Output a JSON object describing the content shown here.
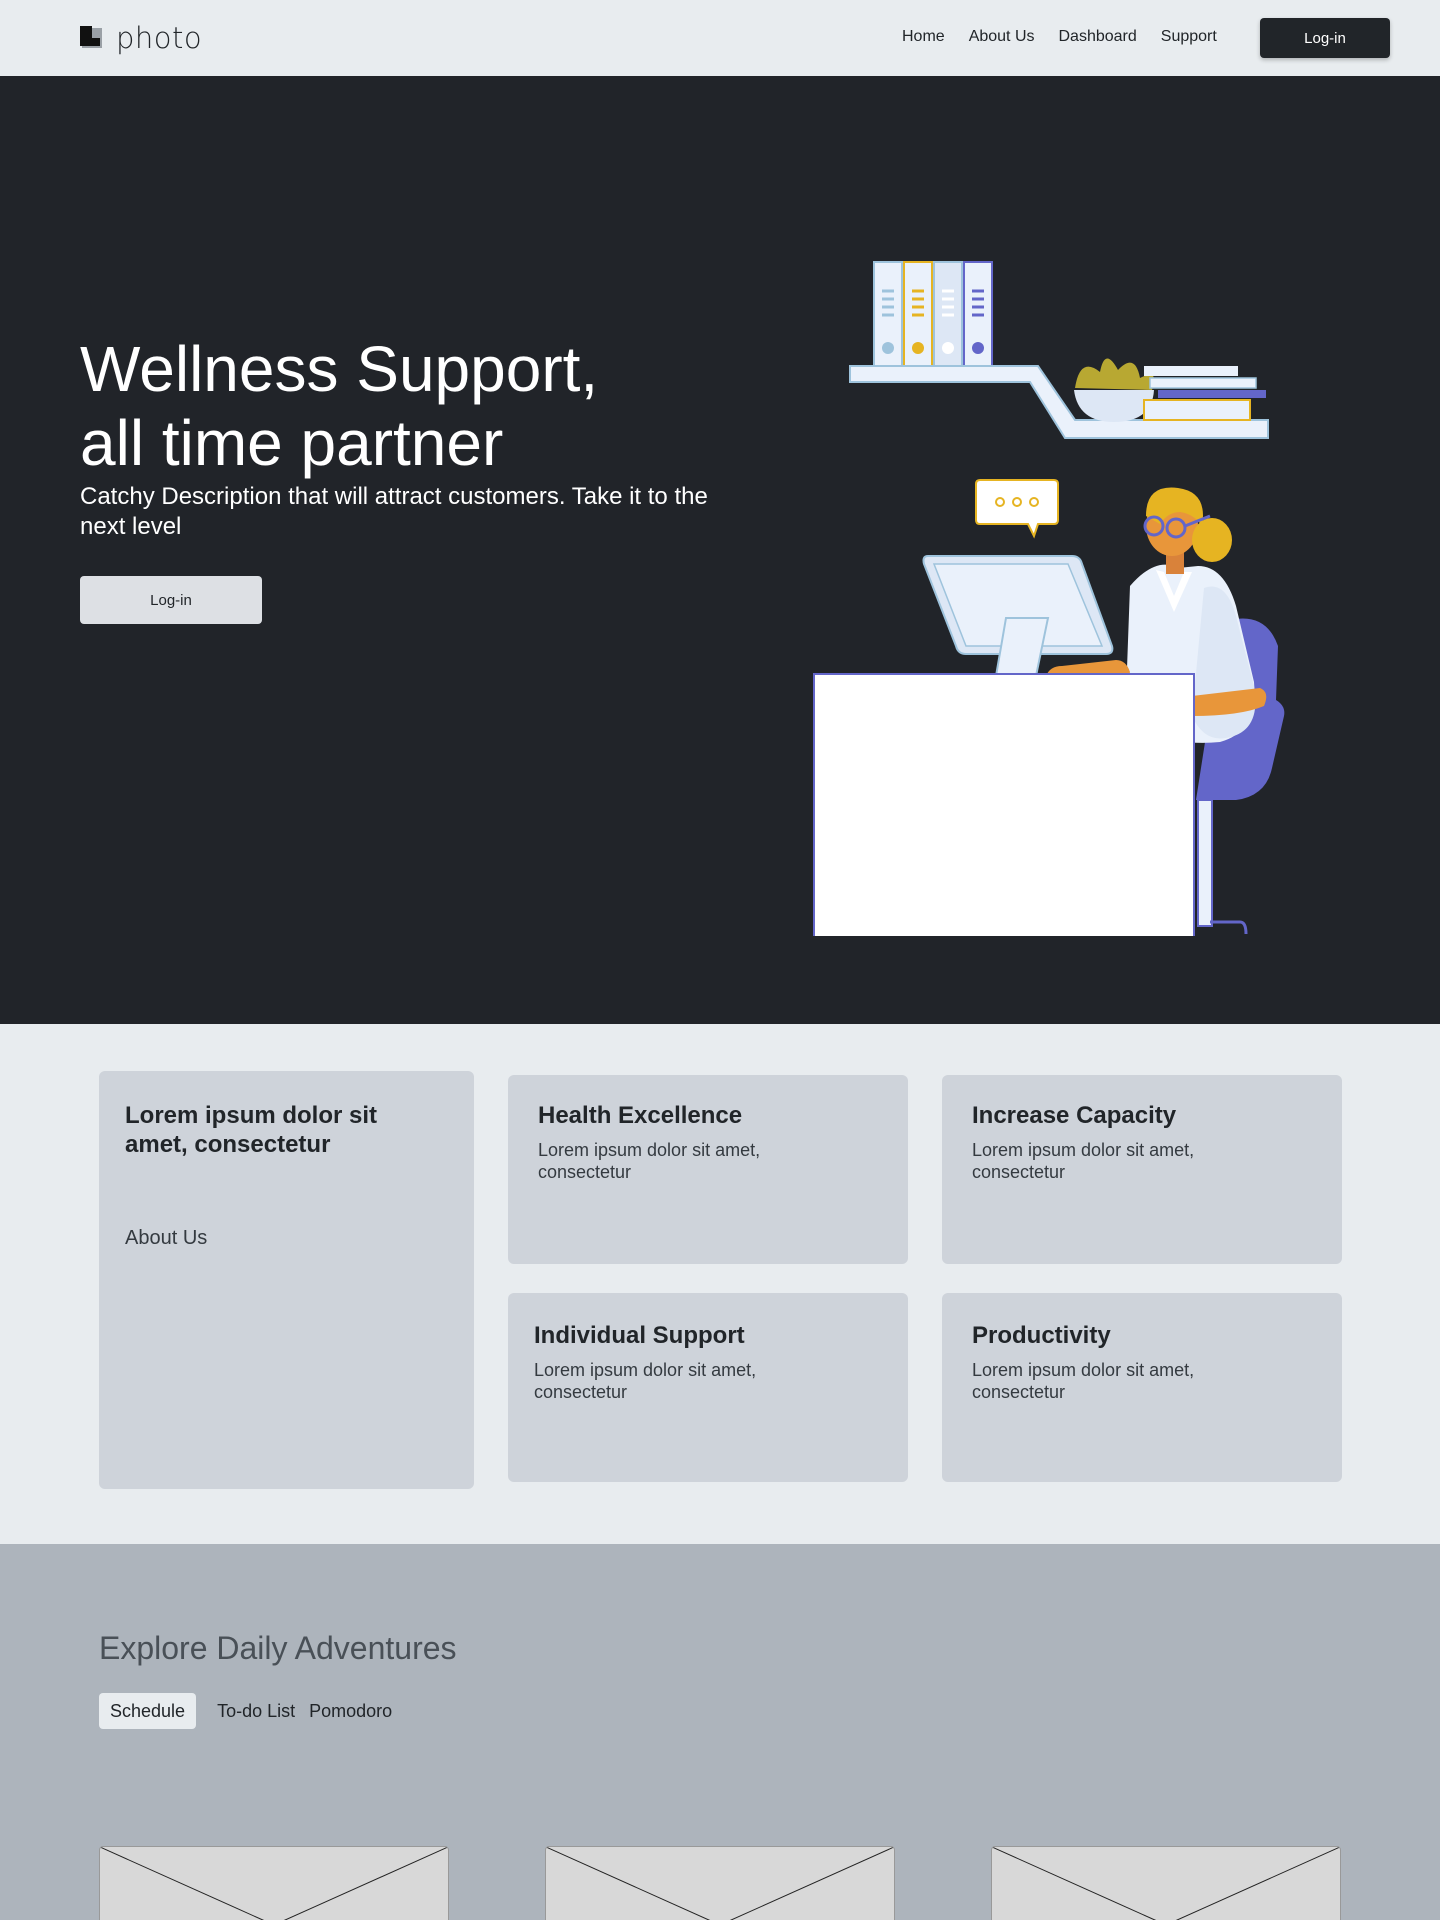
{
  "nav": {
    "logo_text": "photo",
    "links": [
      "Home",
      "About Us",
      "Dashboard",
      "Support"
    ],
    "login_label": "Log-in"
  },
  "hero": {
    "title_line1": "Wellness Support,",
    "title_line2": "all time partner",
    "description": "Catchy Description that will attract customers. Take it to the next level",
    "login_label": "Log-in"
  },
  "features": {
    "intro": {
      "title": "Lorem ipsum dolor sit amet, consectetur",
      "link": "About Us"
    },
    "cards": [
      {
        "title": "Health Excellence",
        "text": "Lorem ipsum dolor sit amet, consectetur"
      },
      {
        "title": "Increase Capacity",
        "text": "Lorem ipsum dolor sit amet, consectetur"
      },
      {
        "title": "Individual Support",
        "text": "Lorem ipsum dolor sit amet, consectetur"
      },
      {
        "title": "Productivity",
        "text": "Lorem ipsum dolor sit amet, consectetur"
      }
    ]
  },
  "explore": {
    "title": "Explore Daily Adventures",
    "tabs": [
      "Schedule",
      "To-do List",
      "Pomodoro"
    ],
    "active_tab": "Schedule"
  },
  "colors": {
    "nav_bg": "#e8ecef",
    "hero_bg": "#212429",
    "button_dark": "#212529",
    "card_bg": "#ced3da",
    "explore_bg": "#adb4bc",
    "accent_purple": "#6366c9",
    "accent_yellow": "#e6b422"
  }
}
